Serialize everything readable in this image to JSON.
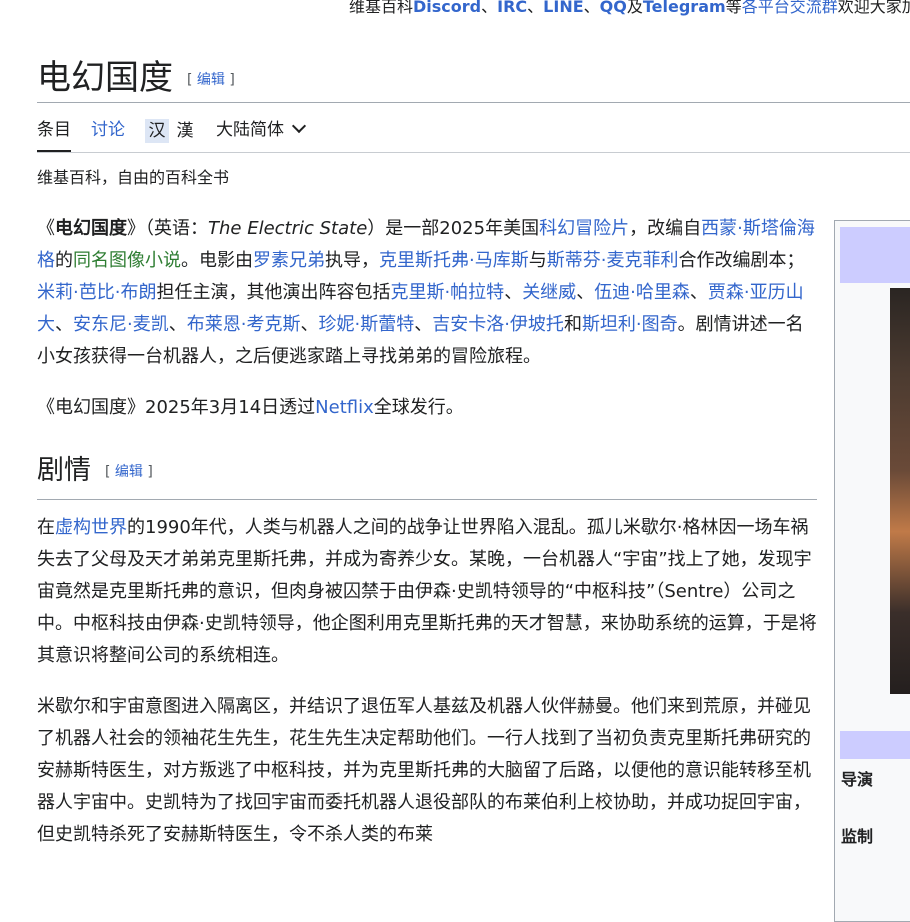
{
  "sitenotice": {
    "prefix": "维基百科",
    "discord": "Discord",
    "sep1": "、",
    "irc": "IRC",
    "sep2": "、",
    "line": "LINE",
    "sep3": "、",
    "qq": "QQ",
    "and": "及",
    "telegram": "Telegram",
    "mid": "等",
    "link": "各平台交流群",
    "suffix": "欢迎大家加入"
  },
  "page": {
    "title": "电幻国度",
    "edit_open": "[ ",
    "edit_label": "编辑",
    "edit_close": " ]"
  },
  "tabs": {
    "article": "条目",
    "talk": "讨论",
    "hans": "汉",
    "hant": "漢",
    "variant": "大陆简体"
  },
  "tagline": "维基百科，自由的百科全书",
  "lead": {
    "p1": {
      "t1": "《",
      "bold": "电幻国度",
      "t2": "》（英语：",
      "italic": "The Electric State",
      "t3": "）是一部2025年美国",
      "l1": "科幻冒险片",
      "t4": "，改编自",
      "l2": "西蒙·斯塔倫海格",
      "t5": "的",
      "l3": "同名图像小说",
      "t6": "。电影由",
      "l4": "罗素兄弟",
      "t7": "执导，",
      "l5": "克里斯托弗·马库斯",
      "t8": "与",
      "l6": "斯蒂芬·麦克菲利",
      "t9": "合作改编剧本；",
      "l7": "米莉·芭比·布朗",
      "t10": "担任主演，其他演出阵容包括",
      "l8": "克里斯·帕拉特",
      "t11": "、",
      "l9": "关继威",
      "t12": "、",
      "l10": "伍迪·哈里森",
      "t13": "、",
      "l11": "贾森·亚历山大",
      "t14": "、",
      "l12": "安东尼·麦凯",
      "t15": "、",
      "l13": "布莱恩·考克斯",
      "t16": "、",
      "l14": "珍妮·斯蕾特",
      "t17": "、",
      "l15": "吉安卡洛·伊坡托",
      "t18": "和",
      "l16": "斯坦利·图奇",
      "t19": "。剧情讲述一名小女孩获得一台机器人，之后便逃家踏上寻找弟弟的冒险旅程。"
    },
    "p2": {
      "t1": "《电幻国度》2025年3月14日透过",
      "l1": "Netflix",
      "t2": "全球发行。"
    }
  },
  "plot": {
    "heading": "剧情",
    "edit_open": "[ ",
    "edit_label": "编辑",
    "edit_close": " ]",
    "p1": {
      "t1": "在",
      "l1": "虚构世界",
      "t2": "的1990年代，人类与机器人之间的战争让世界陷入混乱。孤儿米歇尔·格林因一场车祸失去了父母及天才弟弟克里斯托弗，并成为寄养少女。某晚，一台机器人“宇宙”找上了她，发现宇宙竟然是克里斯托弗的意识，但肉身被囚禁于由伊森·史凯特领导的“中枢科技”（Sentre）公司之中。中枢科技由伊森·史凯特领导，他企图利用克里斯托弗的天才智慧，来协助系统的运算，于是将其意识将整间公司的系统相连。"
    },
    "p2": "米歇尔和宇宙意图进入隔离区，并结识了退伍军人基兹及机器人伙伴赫曼。他们来到荒原，并碰见了机器人社会的领袖花生先生，花生先生决定帮助他们。一行人找到了当初负责克里斯托弗研究的安赫斯特医生，对方叛逃了中枢科技，并为克里斯托弗的大脑留了后路，以便他的意识能转移至机器人宇宙中。史凯特为了找回宇宙而委托机器人退役部队的布莱伯利上校协助，并成功捉回宇宙，但史凯特杀死了安赫斯特医生，令不杀人类的布莱"
  },
  "infobox": {
    "director_label": "导演",
    "producer_label": "监制"
  }
}
